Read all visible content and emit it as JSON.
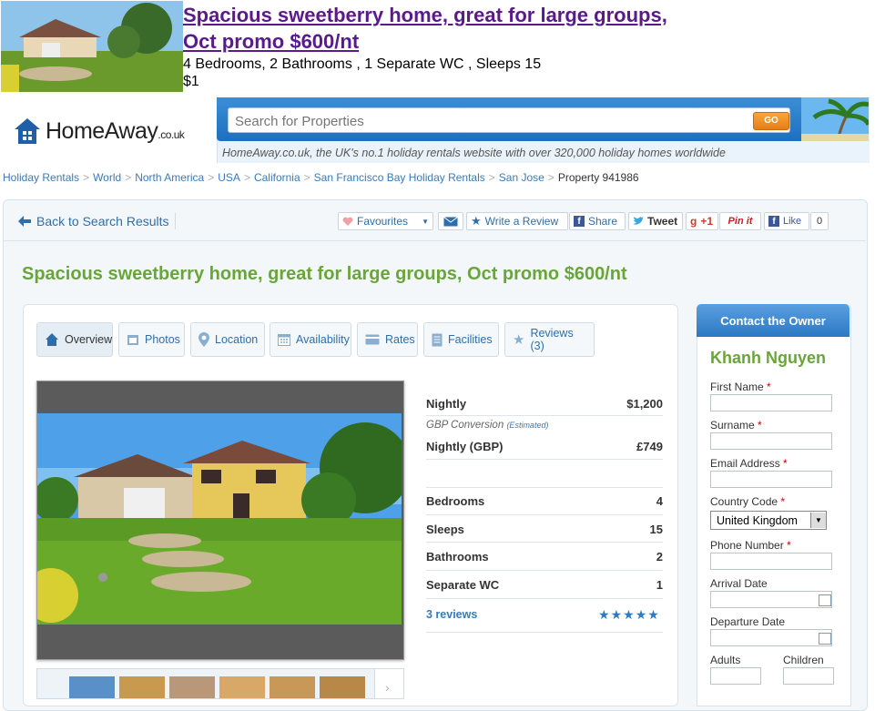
{
  "snippet": {
    "title_line1": "Spacious sweetberry home, great for large groups,",
    "title_line2": "Oct promo $600/nt",
    "specs": "4 Bedrooms, 2 Bathrooms ,  1 Separate WC , Sleeps 15",
    "price": "$1"
  },
  "header": {
    "logo_main": "HomeAway",
    "logo_tld": ".co.uk",
    "search_placeholder": "Search for Properties",
    "go_label": "GO",
    "tagline": "HomeAway.co.uk, the UK's no.1 holiday rentals website with over 320,000 holiday homes worldwide"
  },
  "breadcrumb": {
    "items": [
      "Holiday Rentals",
      "World",
      "North America",
      "USA",
      "California",
      "San Francisco Bay Holiday Rentals",
      "San Jose"
    ],
    "current": "Property 941986"
  },
  "toolbar": {
    "back_label": "Back to Search Results",
    "favourites": "Favourites",
    "write_review": "Write a Review",
    "share": "Share",
    "tweet": "Tweet",
    "gplus": "+1",
    "pinit": "Pin it",
    "like": "Like",
    "like_count": "0"
  },
  "listing": {
    "title": "Spacious sweetberry home, great for large groups, Oct promo $600/nt"
  },
  "tabs": [
    {
      "label": "Overview"
    },
    {
      "label": "Photos"
    },
    {
      "label": "Location"
    },
    {
      "label": "Availability"
    },
    {
      "label": "Rates"
    },
    {
      "label": "Facilities"
    },
    {
      "label": "Reviews (3)"
    }
  ],
  "facts": {
    "nightly_label": "Nightly",
    "nightly_value": "$1,200",
    "gbp_conversion": "GBP Conversion",
    "estimated": "(Estimated)",
    "nightly_gbp_label": "Nightly (GBP)",
    "nightly_gbp_value": "£749",
    "bedrooms_label": "Bedrooms",
    "bedrooms_value": "4",
    "sleeps_label": "Sleeps",
    "sleeps_value": "15",
    "bathrooms_label": "Bathrooms",
    "bathrooms_value": "2",
    "wc_label": "Separate WC",
    "wc_value": "1",
    "reviews_link": "3  reviews",
    "rating_stars": 5
  },
  "contact": {
    "header": "Contact the Owner",
    "owner": "Khanh Nguyen",
    "first_name": "First Name",
    "surname": "Surname",
    "email": "Email Address",
    "country_code": "Country Code",
    "country_value": "United Kingdom",
    "phone": "Phone Number",
    "arrival": "Arrival Date",
    "departure": "Departure Date",
    "adults": "Adults",
    "children": "Children",
    "required_mark": "*"
  },
  "colors": {
    "title_green": "#6aa53a",
    "link_blue": "#3a7ab8",
    "visited_purple": "#5a1a8c",
    "go_orange": "#f08a20"
  }
}
